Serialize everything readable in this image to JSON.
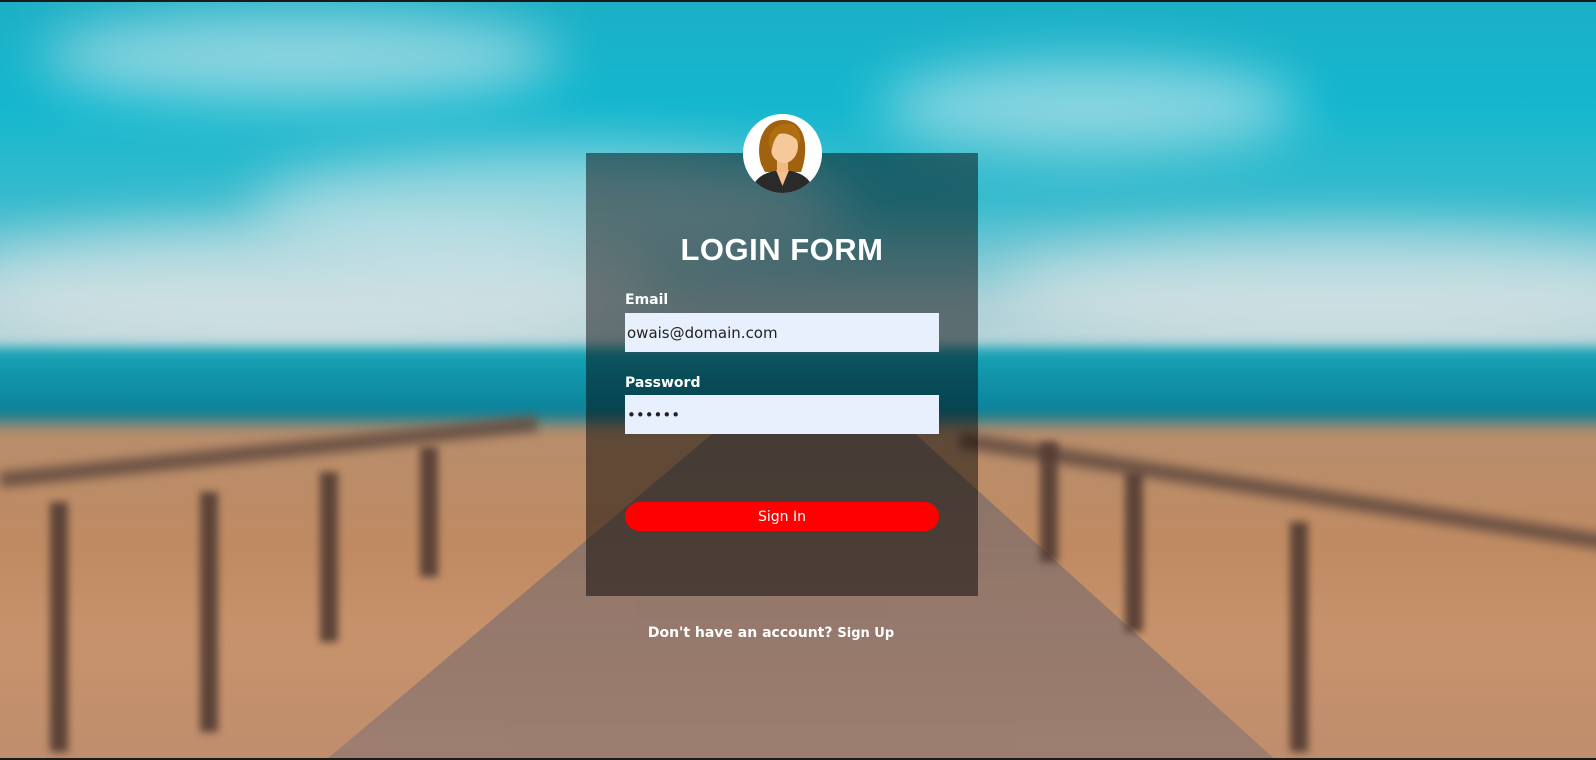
{
  "form": {
    "title": "LOGIN FORM",
    "email_label": "Email",
    "email_value": "owais@domain.com",
    "password_label": "Password",
    "password_value": "123456",
    "submit_label": "Sign In"
  },
  "footer": {
    "prompt": "Don't have an account?",
    "signup_link": "Sign Up"
  },
  "colors": {
    "card_overlay": "rgba(0,0,0,0.48)",
    "input_bg": "#e8f0fe",
    "button_bg": "#ff0000",
    "text": "#ffffff"
  },
  "icons": {
    "avatar": "female-user-avatar"
  }
}
